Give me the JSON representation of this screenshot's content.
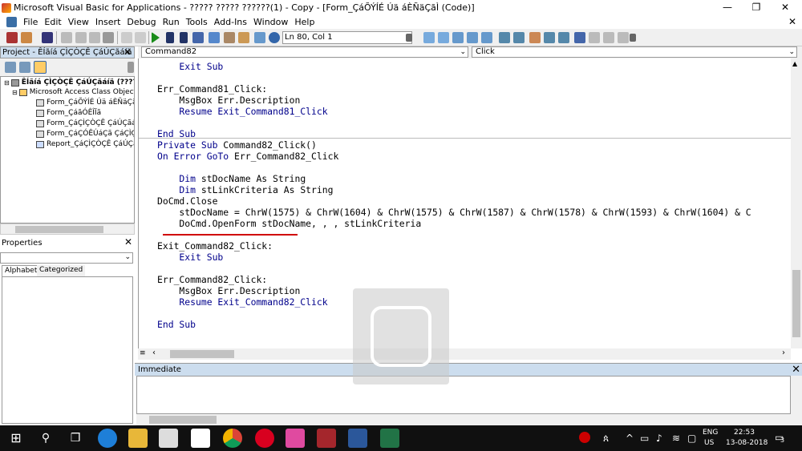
{
  "window": {
    "title": "Microsoft Visual Basic for Applications - ????? ????? ??????(1) - Copy - [Form_ÇáÕÝÍÉ Úä áÈÑäÇãÌ (Code)]",
    "minimize": "—",
    "restore": "❐",
    "close": "✕"
  },
  "menu": [
    "File",
    "Edit",
    "View",
    "Insert",
    "Debug",
    "Run",
    "Tools",
    "Add-Ins",
    "Window",
    "Help"
  ],
  "toolbar": {
    "position": "Ln 80, Col 1"
  },
  "project": {
    "title": "Project - ÊÍãíá ÇÌÇÒÇÊ ÇáÚÇãáíä",
    "close": "✕",
    "root": "ÊÍãíá ÇÌÇÒÇÊ ÇáÚÇãáíä (?????",
    "folder": "Microsoft Access Class Objects",
    "items": [
      "Form_ÇáÕÝÍÉ Úä áÈÑäÇãÌ",
      "Form_ÇáãÓÊÎÏã",
      "Form_ÇáÇÌÇÒÇÊ ÇáÚÇãáíä Subfo",
      "Form_ÇáÇÓÊÚáÇã ÇáÇÌÇÒÇÊ",
      "Report_ÇáÇÌÇÒÇÊ ÇáÚÇãáíä"
    ]
  },
  "properties": {
    "title": "Properties",
    "close": "✕",
    "tab_alpha": "Alphabetic",
    "tab_cat": "Categorized"
  },
  "code": {
    "object_combo": "Command82",
    "proc_combo": "Click",
    "lines": [
      {
        "kw": "",
        "rest": "    Exit Sub",
        "exit": true
      },
      {
        "kw": "",
        "rest": ""
      },
      {
        "kw": "",
        "rest": "Err_Command81_Click:"
      },
      {
        "kw": "",
        "rest": "    MsgBox Err.Description"
      },
      {
        "kw": "",
        "rest": "    Resume Exit_Command81_Click",
        "resume": true
      },
      {
        "kw": "",
        "rest": ""
      },
      {
        "kw": "End Sub",
        "rest": ""
      },
      {
        "kw": "Private Sub",
        "rest": " Command82_Click()"
      },
      {
        "kw": "On Error GoTo",
        "rest": " Err_Command82_Click"
      },
      {
        "kw": "",
        "rest": ""
      },
      {
        "kw": "    Dim",
        "rest": " stDocName As String",
        "as": true
      },
      {
        "kw": "    Dim",
        "rest": " stLinkCriteria As String",
        "as": true
      },
      {
        "kw": "",
        "rest": "DoCmd.Close"
      },
      {
        "kw": "",
        "rest": "    stDocName = ChrW(1575) & ChrW(1604) & ChrW(1575) & ChrW(1587) & ChrW(1578) & ChrW(1593) & ChrW(1604) & C"
      },
      {
        "kw": "",
        "rest": "    DoCmd.OpenForm stDocName, , , stLinkCriteria"
      },
      {
        "kw": "",
        "rest": ""
      },
      {
        "kw": "",
        "rest": "Exit_Command82_Click:"
      },
      {
        "kw": "",
        "rest": "    Exit Sub",
        "exit": true
      },
      {
        "kw": "",
        "rest": ""
      },
      {
        "kw": "",
        "rest": "Err_Command82_Click:"
      },
      {
        "kw": "",
        "rest": "    MsgBox Err.Description"
      },
      {
        "kw": "",
        "rest": "    Resume Exit_Command82_Click",
        "resume": true
      },
      {
        "kw": "",
        "rest": ""
      },
      {
        "kw": "End Sub",
        "rest": ""
      }
    ]
  },
  "immediate": {
    "title": "Immediate",
    "close": "✕"
  },
  "taskbar": {
    "lang": "ENG",
    "region": "US",
    "time": "22:53",
    "date": "13-08-2018",
    "notif": "3"
  },
  "colors": {
    "keyword": "#00008b",
    "underline": "#d00000",
    "taskbar": "#101010"
  }
}
